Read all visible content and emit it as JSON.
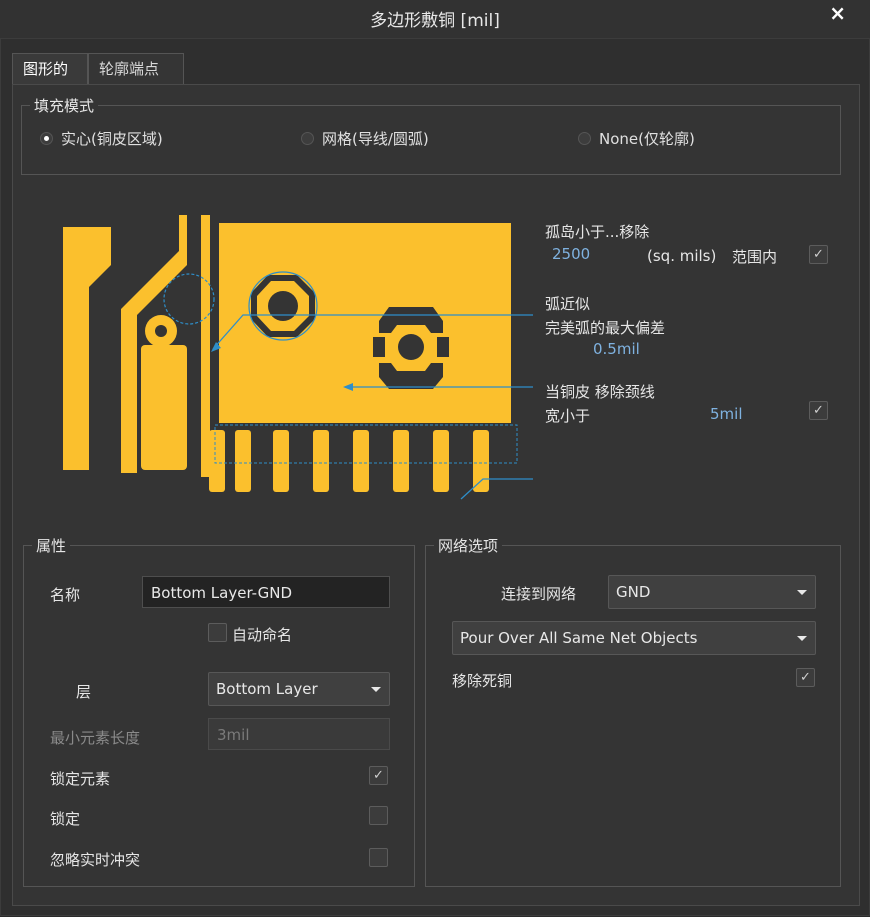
{
  "window": {
    "title": "多边形敷铜 [mil]",
    "close_glyph": "×"
  },
  "tabs": [
    {
      "label": "图形的",
      "active": true
    },
    {
      "label": "轮廓端点",
      "active": false
    }
  ],
  "fill_mode": {
    "legend": "填充模式",
    "options": [
      {
        "label": "实心(铜皮区域)",
        "selected": true
      },
      {
        "label": "网格(导线/圆弧)",
        "selected": false
      },
      {
        "label": "None(仅轮廓)",
        "selected": false
      }
    ]
  },
  "preview": {
    "fill_color": "#fbc02d",
    "annotation_color": "#2e8ec9",
    "island": {
      "label": "孤岛小于...移除",
      "value": "2500",
      "unit": "(sq. mils)",
      "range_label": "范围内",
      "checked": true
    },
    "arc": {
      "label": "弧近似",
      "sublabel": "完美弧的最大偏差",
      "value": "0.5mil"
    },
    "neck": {
      "label": "当铜皮 移除颈线",
      "sublabel": "宽小于",
      "value": "5mil",
      "checked": true
    }
  },
  "properties": {
    "legend": "属性",
    "name_label": "名称",
    "name_value": "Bottom Layer-GND",
    "auto_name_label": "自动命名",
    "auto_name_checked": false,
    "layer_label": "层",
    "layer_value": "Bottom Layer",
    "min_len_label": "最小元素长度",
    "min_len_value": "3mil",
    "lock_primitives_label": "锁定元素",
    "lock_primitives_checked": true,
    "locked_label": "锁定",
    "locked_checked": false,
    "ignore_label": "忽略实时冲突",
    "ignore_checked": false
  },
  "net_options": {
    "legend": "网络选项",
    "connect_label": "连接到网络",
    "net_value": "GND",
    "pour_value": "Pour Over All Same Net Objects",
    "remove_dead_label": "移除死铜",
    "remove_dead_checked": true
  },
  "icons": {
    "check": "✓"
  }
}
